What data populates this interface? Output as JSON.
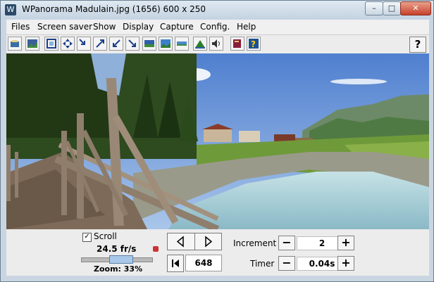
{
  "window": {
    "title": "WPanorama  Madulain.jpg  (1656) 600 x 250",
    "minimize_label": "–",
    "maximize_label": "□",
    "close_label": "✕"
  },
  "menu": [
    "Files",
    "Screen saver",
    "Show",
    "Display",
    "Capture",
    "Config.",
    "Help"
  ],
  "toolbar": {
    "buttons": [
      "open-icon",
      "picture-icon",
      "frame-icon",
      "move-icon",
      "shrink-icon",
      "expand-icon",
      "diagonal-in-icon",
      "diagonal-out-icon",
      "view-icon",
      "landscape-icon",
      "strip-icon",
      "mountain-icon",
      "sound-icon",
      "book-icon",
      "help-question-icon"
    ],
    "help_label": "?"
  },
  "controls": {
    "scroll_label": "Scroll",
    "scroll_checked": true,
    "frame_rate": "24.5 fr/s",
    "zoom": "Zoom: 33%",
    "counter": "648",
    "increment_label": "Increment",
    "increment_value": "2",
    "timer_label": "Timer",
    "timer_value": "0.04s",
    "minus": "−",
    "plus": "+"
  },
  "colors": {
    "sky": "#6f9ad9",
    "water": "#a9cfd9",
    "grass": "#5c8a2e",
    "bridge": "#8a7865"
  }
}
